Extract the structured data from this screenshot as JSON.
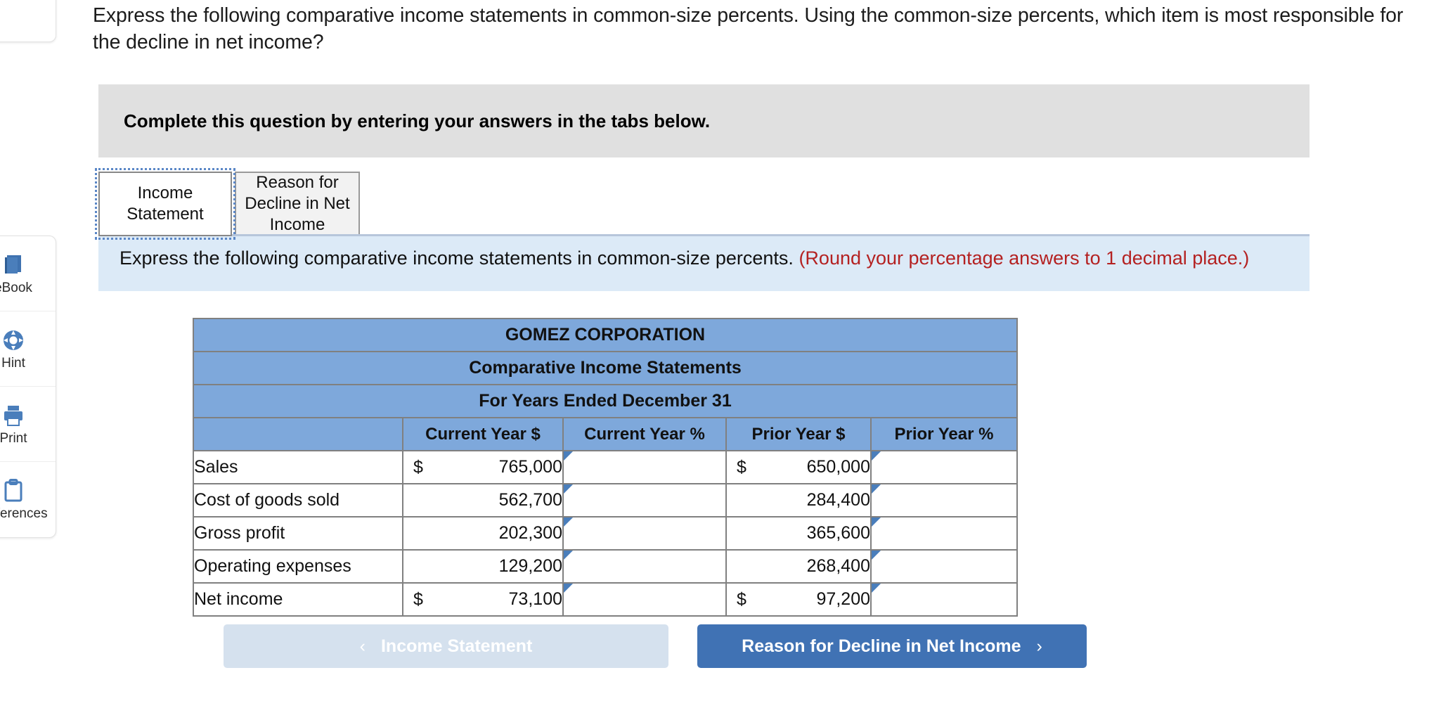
{
  "sidebar": {
    "items": [
      {
        "label": "eBook",
        "icon": "ebook-icon"
      },
      {
        "label": "Hint",
        "icon": "lifesaver-hint-icon"
      },
      {
        "label": "Print",
        "icon": "printer-icon"
      },
      {
        "label": "References",
        "icon": "clipboard-references-icon"
      }
    ]
  },
  "question": {
    "prompt": "Express the following comparative income statements in common-size percents. Using the common-size percents, which item is most responsible for the decline in net income?"
  },
  "complete_banner": {
    "text": "Complete this question by entering your answers in the tabs below."
  },
  "tabs": [
    {
      "label": "Income Statement",
      "active": true
    },
    {
      "label": "Reason for Decline in Net Income",
      "active": false
    }
  ],
  "instruction": {
    "main": "Express the following comparative income statements in common-size percents.",
    "note": "(Round your percentage answers to 1 decimal place.)"
  },
  "statement": {
    "title_lines": [
      "GOMEZ CORPORATION",
      "Comparative Income Statements",
      "For Years Ended December 31"
    ],
    "columns": [
      "",
      "Current Year $",
      "Current Year %",
      "Prior Year $",
      "Prior Year %"
    ],
    "rows": [
      {
        "label": "Sales",
        "current_symbol": "$",
        "current_amount": "765,000",
        "current_percent": "",
        "prior_symbol": "$",
        "prior_amount": "650,000",
        "prior_percent": ""
      },
      {
        "label": "Cost of goods sold",
        "current_symbol": "",
        "current_amount": "562,700",
        "current_percent": "",
        "prior_symbol": "",
        "prior_amount": "284,400",
        "prior_percent": ""
      },
      {
        "label": "Gross profit",
        "current_symbol": "",
        "current_amount": "202,300",
        "current_percent": "",
        "prior_symbol": "",
        "prior_amount": "365,600",
        "prior_percent": ""
      },
      {
        "label": "Operating expenses",
        "current_symbol": "",
        "current_amount": "129,200",
        "current_percent": "",
        "prior_symbol": "",
        "prior_amount": "268,400",
        "prior_percent": ""
      },
      {
        "label": "Net income",
        "current_symbol": "$",
        "current_amount": "73,100",
        "current_percent": "",
        "prior_symbol": "$",
        "prior_amount": "97,200",
        "prior_percent": ""
      }
    ]
  },
  "nav": {
    "prev_label": "Income Statement",
    "prev_chevron": "‹",
    "next_label": "Reason for Decline in Net Income",
    "next_chevron": "›"
  },
  "colors": {
    "header_blue": "#7ea8db",
    "input_border_blue": "#4a7ebb",
    "banner_gray": "#e0e0e0",
    "instruction_blue": "#dceaf7",
    "note_red": "#b42121",
    "next_button_blue": "#4072b4",
    "prev_button_blue": "#d5e1ee"
  }
}
